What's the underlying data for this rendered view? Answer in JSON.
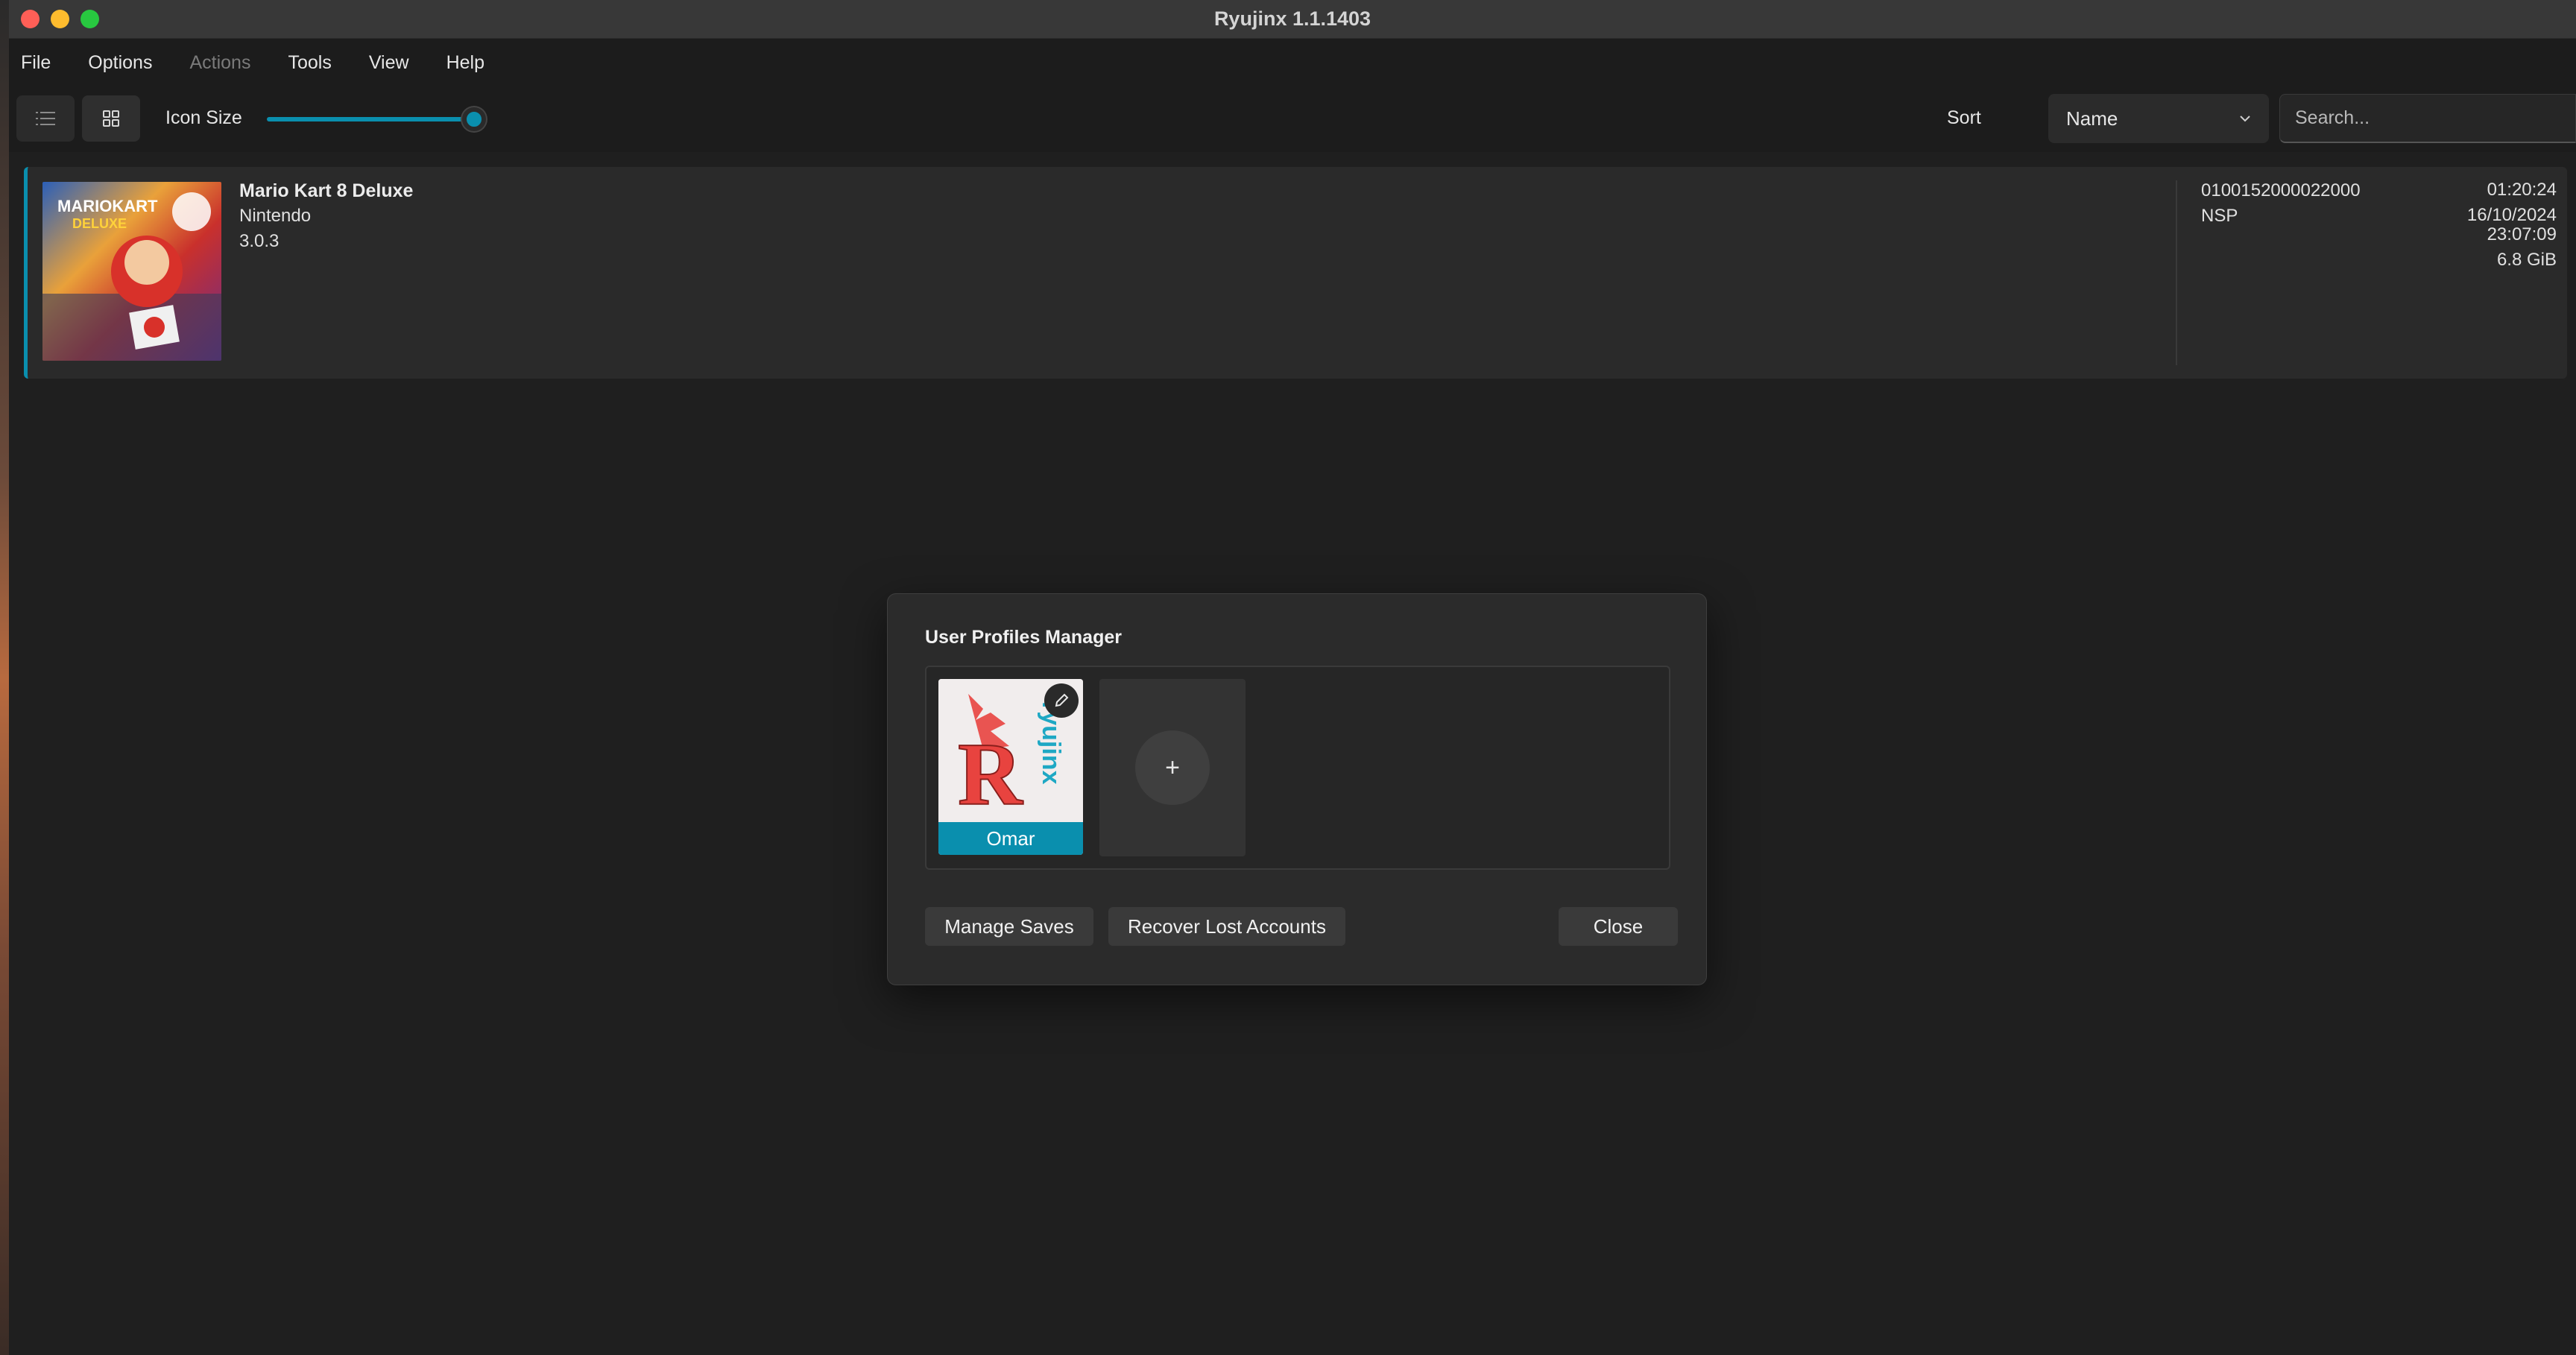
{
  "window": {
    "title": "Ryujinx 1.1.1403"
  },
  "menu": {
    "items": [
      {
        "label": "File",
        "enabled": true
      },
      {
        "label": "Options",
        "enabled": true
      },
      {
        "label": "Actions",
        "enabled": false
      },
      {
        "label": "Tools",
        "enabled": true
      },
      {
        "label": "View",
        "enabled": true
      },
      {
        "label": "Help",
        "enabled": true
      }
    ]
  },
  "toolbar": {
    "icon_size_label": "Icon Size",
    "icon_size_value": 1.0,
    "sort_label": "Sort",
    "sort_value": "Name",
    "search_placeholder": "Search..."
  },
  "games": [
    {
      "title": "Mario Kart 8 Deluxe",
      "developer": "Nintendo",
      "version": "3.0.3",
      "title_id": "0100152000022000",
      "format": "NSP",
      "play_time": "01:20:24",
      "last_played_date": "16/10/2024",
      "last_played_time": "23:07:09",
      "size": "6.8 GiB"
    }
  ],
  "dialog": {
    "title": "User Profiles Manager",
    "profiles": [
      {
        "name": "Omar"
      }
    ],
    "buttons": {
      "manage_saves": "Manage Saves",
      "recover": "Recover Lost Accounts",
      "close": "Close"
    }
  },
  "colors": {
    "accent": "#0a8fae",
    "background": "#1f1f1f",
    "panel": "#2b2b2b"
  }
}
